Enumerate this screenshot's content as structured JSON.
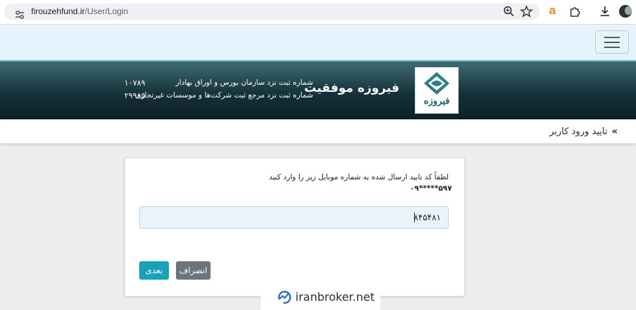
{
  "browser": {
    "url_host": "firouzehfund.ir",
    "url_path": "/User/Login"
  },
  "header": {
    "brand_name": "فیروزه موفقیت",
    "logo_text": "فیروزه",
    "registration_line_1": "شماره ثبت نزد سازمان بورس و اوراق بهادار",
    "registration_number_1": "۱۰۷۸۹",
    "registration_line_2": "شماره ثبت نزد مرجع ثبت شرکت‌ها و موسسات غیرتجاری",
    "registration_number_2": "۲۹۹۸۵"
  },
  "breadcrumb": {
    "arrow": "»",
    "title": "تایید ورود کاربر"
  },
  "verify_form": {
    "instruction": "لطفاً کد تایید ارسال شده به شماره موبایل زیر را وارد کنید",
    "phone_masked": "۰۹*****۵۹۷",
    "code_value": "۸۴۵۴۸۱",
    "next_label": "بعدی",
    "cancel_label": "انصراف"
  },
  "watermark": {
    "text": "iranbroker.net"
  },
  "colors": {
    "navbar_bg": "#e5f3fc",
    "banner_dark": "#0c1f25",
    "next_button": "#17a2b8",
    "cancel_button": "#6c757d",
    "url_accent": "#e8852a"
  }
}
